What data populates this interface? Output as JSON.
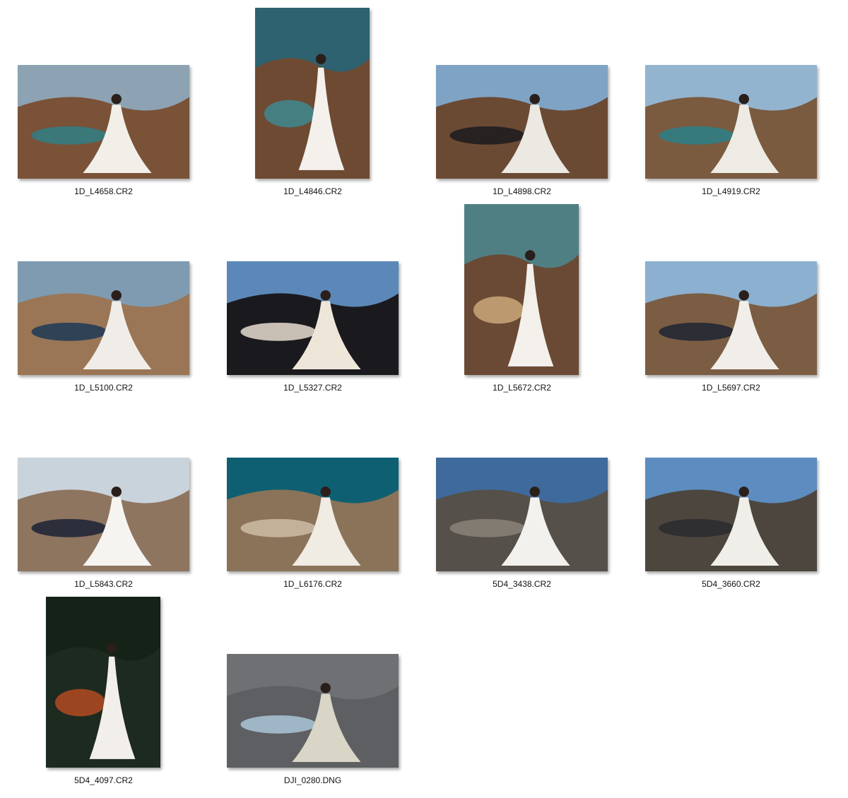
{
  "files": [
    {
      "name": "1D_L4658.CR2",
      "orientation": "landscape",
      "icon": "image-thumbnail-icon",
      "colors": {
        "sky": "#8da3b3",
        "ground": "#7a5238",
        "accent": "#2f7f86",
        "subject": "#f2efe9"
      }
    },
    {
      "name": "1D_L4846.CR2",
      "orientation": "portrait",
      "icon": "image-thumbnail-icon",
      "colors": {
        "sky": "#2e6270",
        "ground": "#6e4a33",
        "accent": "#3f8890",
        "subject": "#f4f1ec"
      }
    },
    {
      "name": "1D_L4898.CR2",
      "orientation": "landscape",
      "icon": "image-thumbnail-icon",
      "colors": {
        "sky": "#7fa3c4",
        "ground": "#6b4a34",
        "accent": "#1b1b1f",
        "subject": "#ece9e3"
      }
    },
    {
      "name": "1D_L4919.CR2",
      "orientation": "landscape",
      "icon": "image-thumbnail-icon",
      "colors": {
        "sky": "#93b4cf",
        "ground": "#7a5b40",
        "accent": "#2b8088",
        "subject": "#eeebe5"
      }
    },
    {
      "name": "1D_L5100.CR2",
      "orientation": "landscape",
      "icon": "image-thumbnail-icon",
      "colors": {
        "sky": "#7f9bb1",
        "ground": "#9a7656",
        "accent": "#1d3a56",
        "subject": "#f0ede8"
      }
    },
    {
      "name": "1D_L5327.CR2",
      "orientation": "landscape",
      "icon": "image-thumbnail-icon",
      "colors": {
        "sky": "#5b88b8",
        "ground": "#1a1a1e",
        "accent": "#e7ddd0",
        "subject": "#efe6da"
      }
    },
    {
      "name": "1D_L5672.CR2",
      "orientation": "portrait",
      "icon": "image-thumbnail-icon",
      "colors": {
        "sky": "#4f7f83",
        "ground": "#6a4a34",
        "accent": "#caa77a",
        "subject": "#f3f0ec"
      }
    },
    {
      "name": "1D_L5697.CR2",
      "orientation": "landscape",
      "icon": "image-thumbnail-icon",
      "colors": {
        "sky": "#8cb0cf",
        "ground": "#7b5d44",
        "accent": "#1e2433",
        "subject": "#f1eee9"
      }
    },
    {
      "name": "1D_L5843.CR2",
      "orientation": "landscape",
      "icon": "image-thumbnail-icon",
      "colors": {
        "sky": "#c9d3dc",
        "ground": "#8e7560",
        "accent": "#1b2235",
        "subject": "#f6f4f0"
      }
    },
    {
      "name": "1D_L6176.CR2",
      "orientation": "landscape",
      "icon": "image-thumbnail-icon",
      "colors": {
        "sky": "#0f5f73",
        "ground": "#8a7358",
        "accent": "#cdbda5",
        "subject": "#f0ebe3"
      }
    },
    {
      "name": "5D4_3438.CR2",
      "orientation": "landscape",
      "icon": "image-thumbnail-icon",
      "colors": {
        "sky": "#3f6a9c",
        "ground": "#55504a",
        "accent": "#8a8378",
        "subject": "#f2f1ee"
      }
    },
    {
      "name": "5D4_3660.CR2",
      "orientation": "landscape",
      "icon": "image-thumbnail-icon",
      "colors": {
        "sky": "#5d8dc0",
        "ground": "#4d463f",
        "accent": "#2a2a2e",
        "subject": "#f0eee9"
      }
    },
    {
      "name": "5D4_4097.CR2",
      "orientation": "portrait",
      "icon": "image-thumbnail-icon",
      "colors": {
        "sky": "#152218",
        "ground": "#1c2a20",
        "accent": "#b34a22",
        "subject": "#f2efea"
      }
    },
    {
      "name": "DJI_0280.DNG",
      "orientation": "landscape",
      "icon": "image-thumbnail-icon",
      "colors": {
        "sky": "#6f7073",
        "ground": "#5e5f62",
        "accent": "#a9c6d8",
        "subject": "#d9d6c8"
      }
    }
  ]
}
